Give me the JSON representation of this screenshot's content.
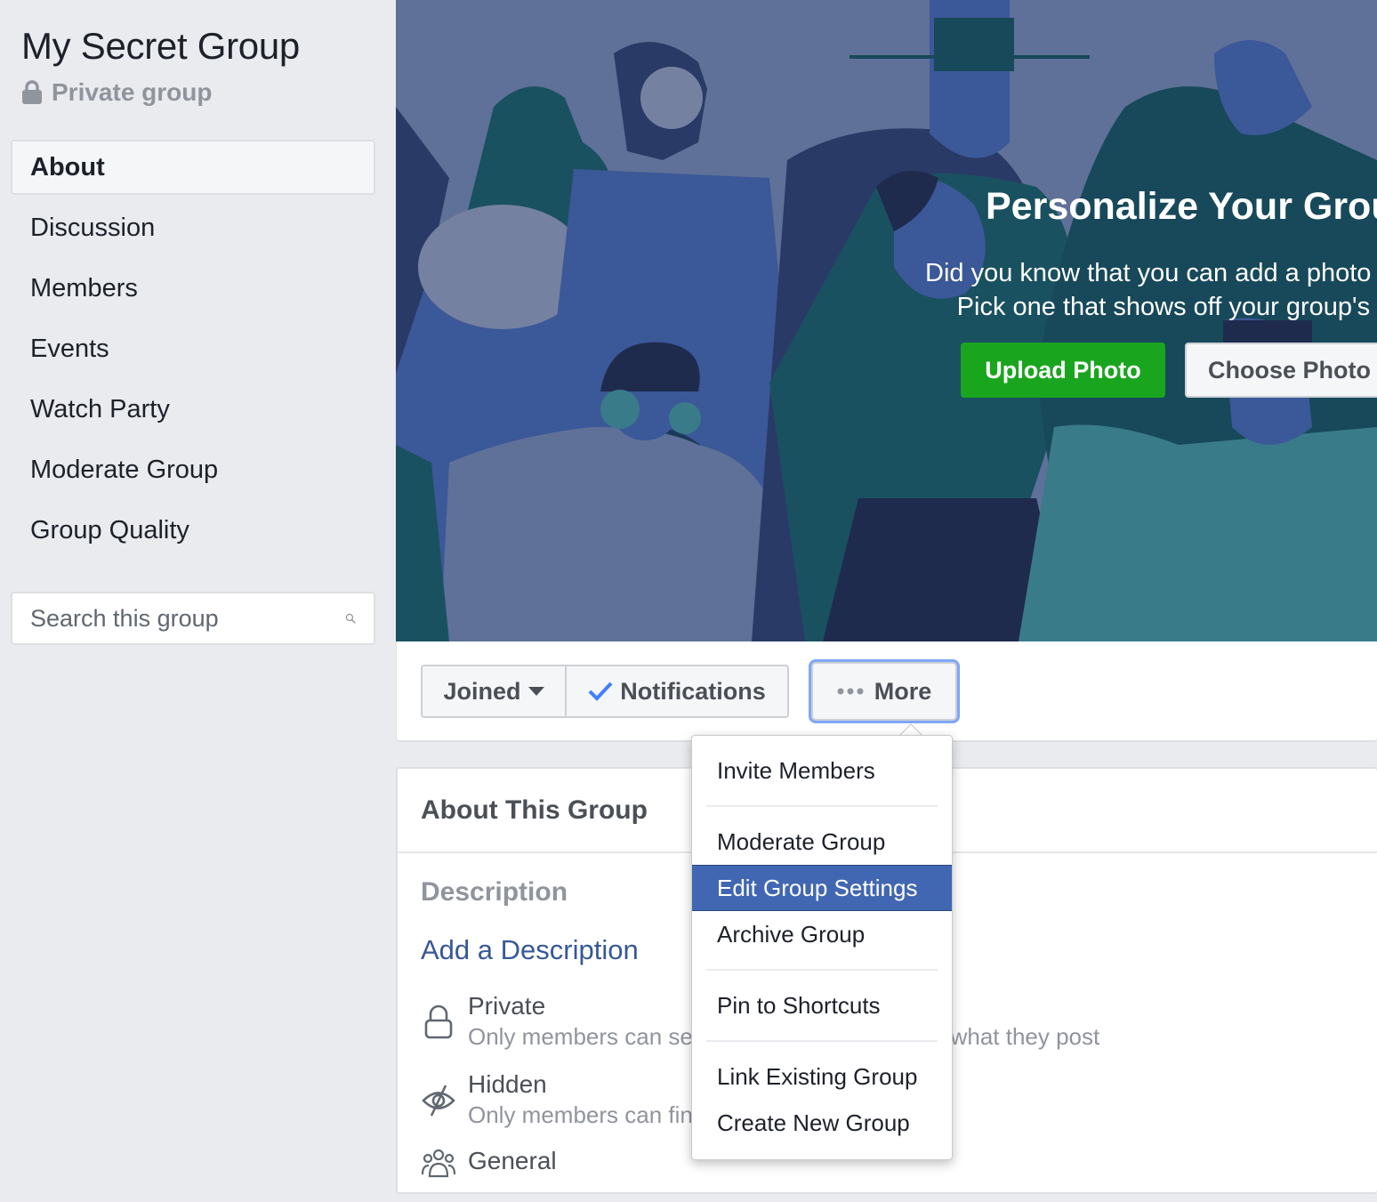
{
  "sidebar": {
    "group_name": "My Secret Group",
    "privacy_label": "Private group",
    "privacy_icon": "lock-icon",
    "nav": [
      {
        "label": "About",
        "active": true
      },
      {
        "label": "Discussion"
      },
      {
        "label": "Members"
      },
      {
        "label": "Events"
      },
      {
        "label": "Watch Party"
      },
      {
        "label": "Moderate Group"
      },
      {
        "label": "Group Quality"
      }
    ],
    "search": {
      "placeholder": "Search this group",
      "value": "",
      "icon": "search-icon"
    }
  },
  "cover": {
    "title": "Personalize Your Group",
    "subtitle_line1": "Did you know that you can add a photo or illustration?",
    "subtitle_line2": "Pick one that shows off your group's personality.",
    "upload_label": "Upload Photo",
    "choose_label": "Choose Photo",
    "upload_color": "#1aa51f"
  },
  "actions": {
    "joined_label": "Joined",
    "notifications_label": "Notifications",
    "more_label": "More"
  },
  "about": {
    "heading": "About This Group",
    "description_label": "Description",
    "add_description": "Add a Description",
    "rows": [
      {
        "icon": "lock-outline-icon",
        "title": "Private",
        "subtitle": "Only members can see who's in the group and what they post"
      },
      {
        "icon": "eye-slash-icon",
        "title": "Hidden",
        "subtitle": "Only members can find this group"
      },
      {
        "icon": "people-icon",
        "title": "General",
        "subtitle": ""
      }
    ]
  },
  "menu": {
    "items": [
      {
        "label": "Invite Members"
      },
      {
        "label": "Moderate Group"
      },
      {
        "label": "Edit Group Settings",
        "highlighted": true
      },
      {
        "label": "Archive Group"
      },
      {
        "label": "Pin to Shortcuts"
      },
      {
        "label": "Link Existing Group"
      },
      {
        "label": "Create New Group"
      }
    ],
    "highlight_color": "#4267b2"
  }
}
